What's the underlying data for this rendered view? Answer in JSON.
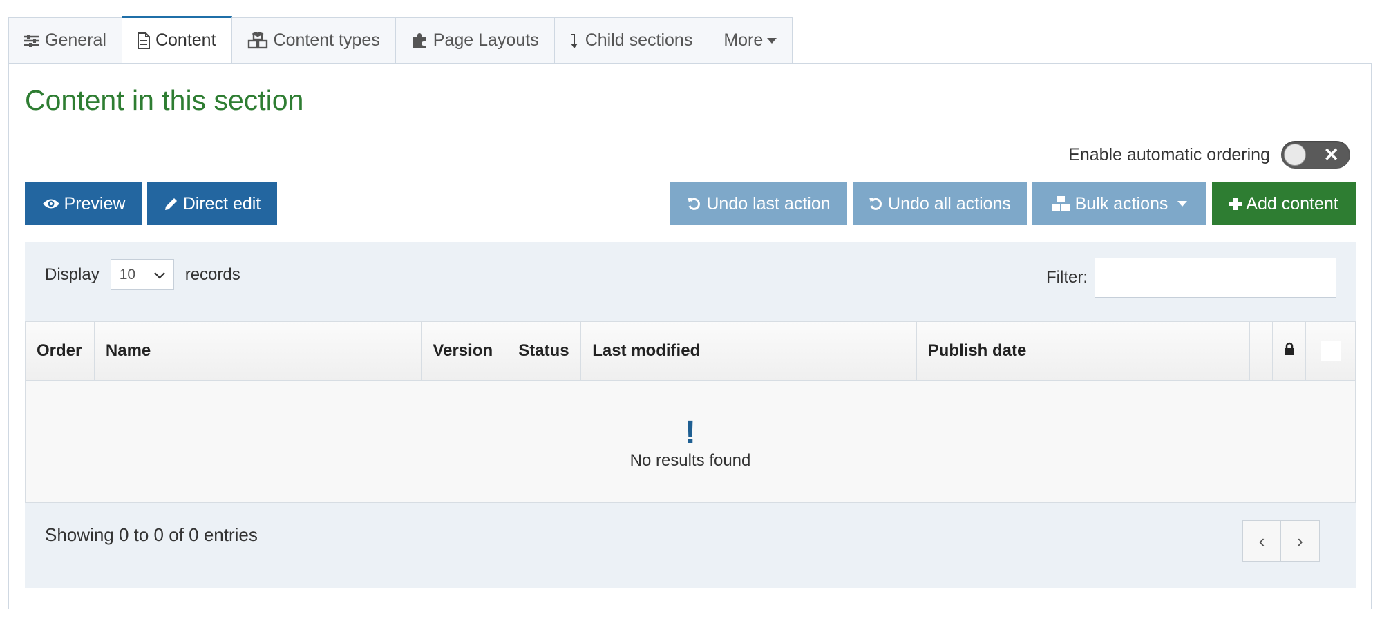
{
  "tabs": [
    {
      "label": "General",
      "icon": "sliders-icon"
    },
    {
      "label": "Content",
      "icon": "file-icon",
      "active": true
    },
    {
      "label": "Content types",
      "icon": "cubes-icon"
    },
    {
      "label": "Page Layouts",
      "icon": "puzzle-icon"
    },
    {
      "label": "Child sections",
      "icon": "arrow-down-icon"
    },
    {
      "label": "More",
      "icon": "caret-down-icon"
    }
  ],
  "section": {
    "title": "Content in this section",
    "auto_ordering_label": "Enable automatic ordering",
    "auto_ordering_enabled": false
  },
  "toolbar": {
    "preview_label": "Preview",
    "direct_edit_label": "Direct edit",
    "undo_last_label": "Undo last action",
    "undo_all_label": "Undo all actions",
    "bulk_actions_label": "Bulk actions",
    "add_content_label": "Add content"
  },
  "table_controls": {
    "display_label": "Display",
    "page_size": "10",
    "records_label": "records",
    "filter_label": "Filter:",
    "filter_value": ""
  },
  "table": {
    "columns": [
      "Order",
      "Name",
      "Version",
      "Status",
      "Last modified",
      "Publish date"
    ],
    "empty_message": "No results found",
    "rows": []
  },
  "footer": {
    "showing_text": "Showing 0 to 0 of 0 entries",
    "prev_label": "‹",
    "next_label": "›"
  },
  "colors": {
    "title_green": "#2e7d32",
    "primary_blue": "#2366a0",
    "disabled_blue": "#7ea8c9",
    "add_green": "#2e7d32"
  }
}
